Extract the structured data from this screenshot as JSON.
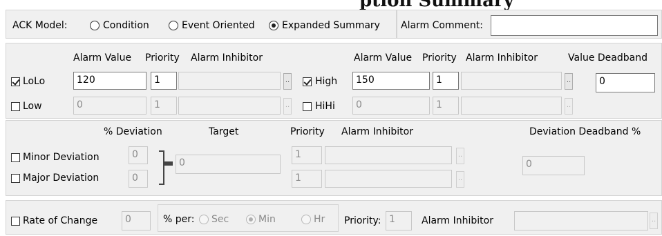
{
  "top_cut_text": "ption Summary",
  "ack": {
    "label": "ACK Model:",
    "options": [
      "Condition",
      "Event Oriented",
      "Expanded Summary"
    ],
    "selected": "Expanded Summary",
    "comment_label": "Alarm Comment:",
    "comment_value": ""
  },
  "limits": {
    "left_headers": {
      "alarm_value": "Alarm Value",
      "priority": "Priority",
      "inhibitor": "Alarm Inhibitor"
    },
    "right_headers": {
      "alarm_value": "Alarm Value",
      "priority": "Priority",
      "inhibitor": "Alarm Inhibitor",
      "deadband": "Value Deadband"
    },
    "lolo": {
      "label": "LoLo",
      "checked": true,
      "value": "120",
      "priority": "1"
    },
    "low": {
      "label": "Low",
      "checked": false,
      "value": "0",
      "priority": "1"
    },
    "high": {
      "label": "High",
      "checked": true,
      "value": "150",
      "priority": "1"
    },
    "hihi": {
      "label": "HiHi",
      "checked": false,
      "value": "0",
      "priority": "1"
    },
    "deadband_value": "0",
    "dots": ".."
  },
  "deviation": {
    "pct_header": "% Deviation",
    "target_header": "Target",
    "priority_header": "Priority",
    "inhibitor_header": "Alarm Inhibitor",
    "deadband_header": "Deviation Deadband %",
    "minor": {
      "label": "Minor Deviation",
      "value": "0",
      "priority": "1"
    },
    "major": {
      "label": "Major Deviation",
      "value": "0",
      "priority": "1"
    },
    "target_value": "0",
    "deadband_value": "0"
  },
  "roc": {
    "label": "Rate of Change",
    "value": "0",
    "per_label": "% per:",
    "units": [
      "Sec",
      "Min",
      "Hr"
    ],
    "selected_unit": "Min",
    "priority_label": "Priority:",
    "priority_value": "1",
    "inhibitor_label": "Alarm Inhibitor"
  }
}
